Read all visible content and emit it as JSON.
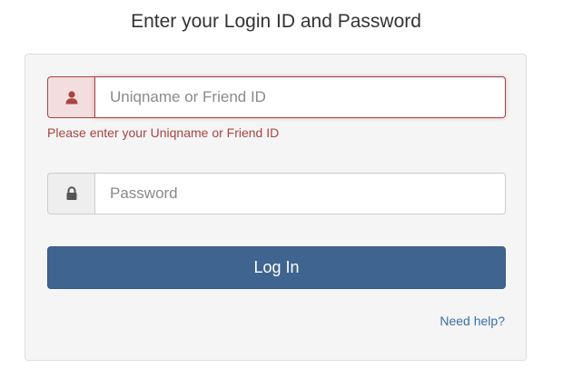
{
  "heading": "Enter your Login ID and Password",
  "username": {
    "icon": "user-icon",
    "placeholder": "Uniqname or Friend ID",
    "value": "",
    "error": "Please enter your Uniqname or Friend ID"
  },
  "password": {
    "icon": "lock-icon",
    "placeholder": "Password",
    "value": ""
  },
  "login_button": "Log In",
  "help_link": "Need help?",
  "colors": {
    "primary": "#3f6490",
    "error": "#a94442",
    "link": "#3a6fa5",
    "panel": "#f5f5f5"
  }
}
